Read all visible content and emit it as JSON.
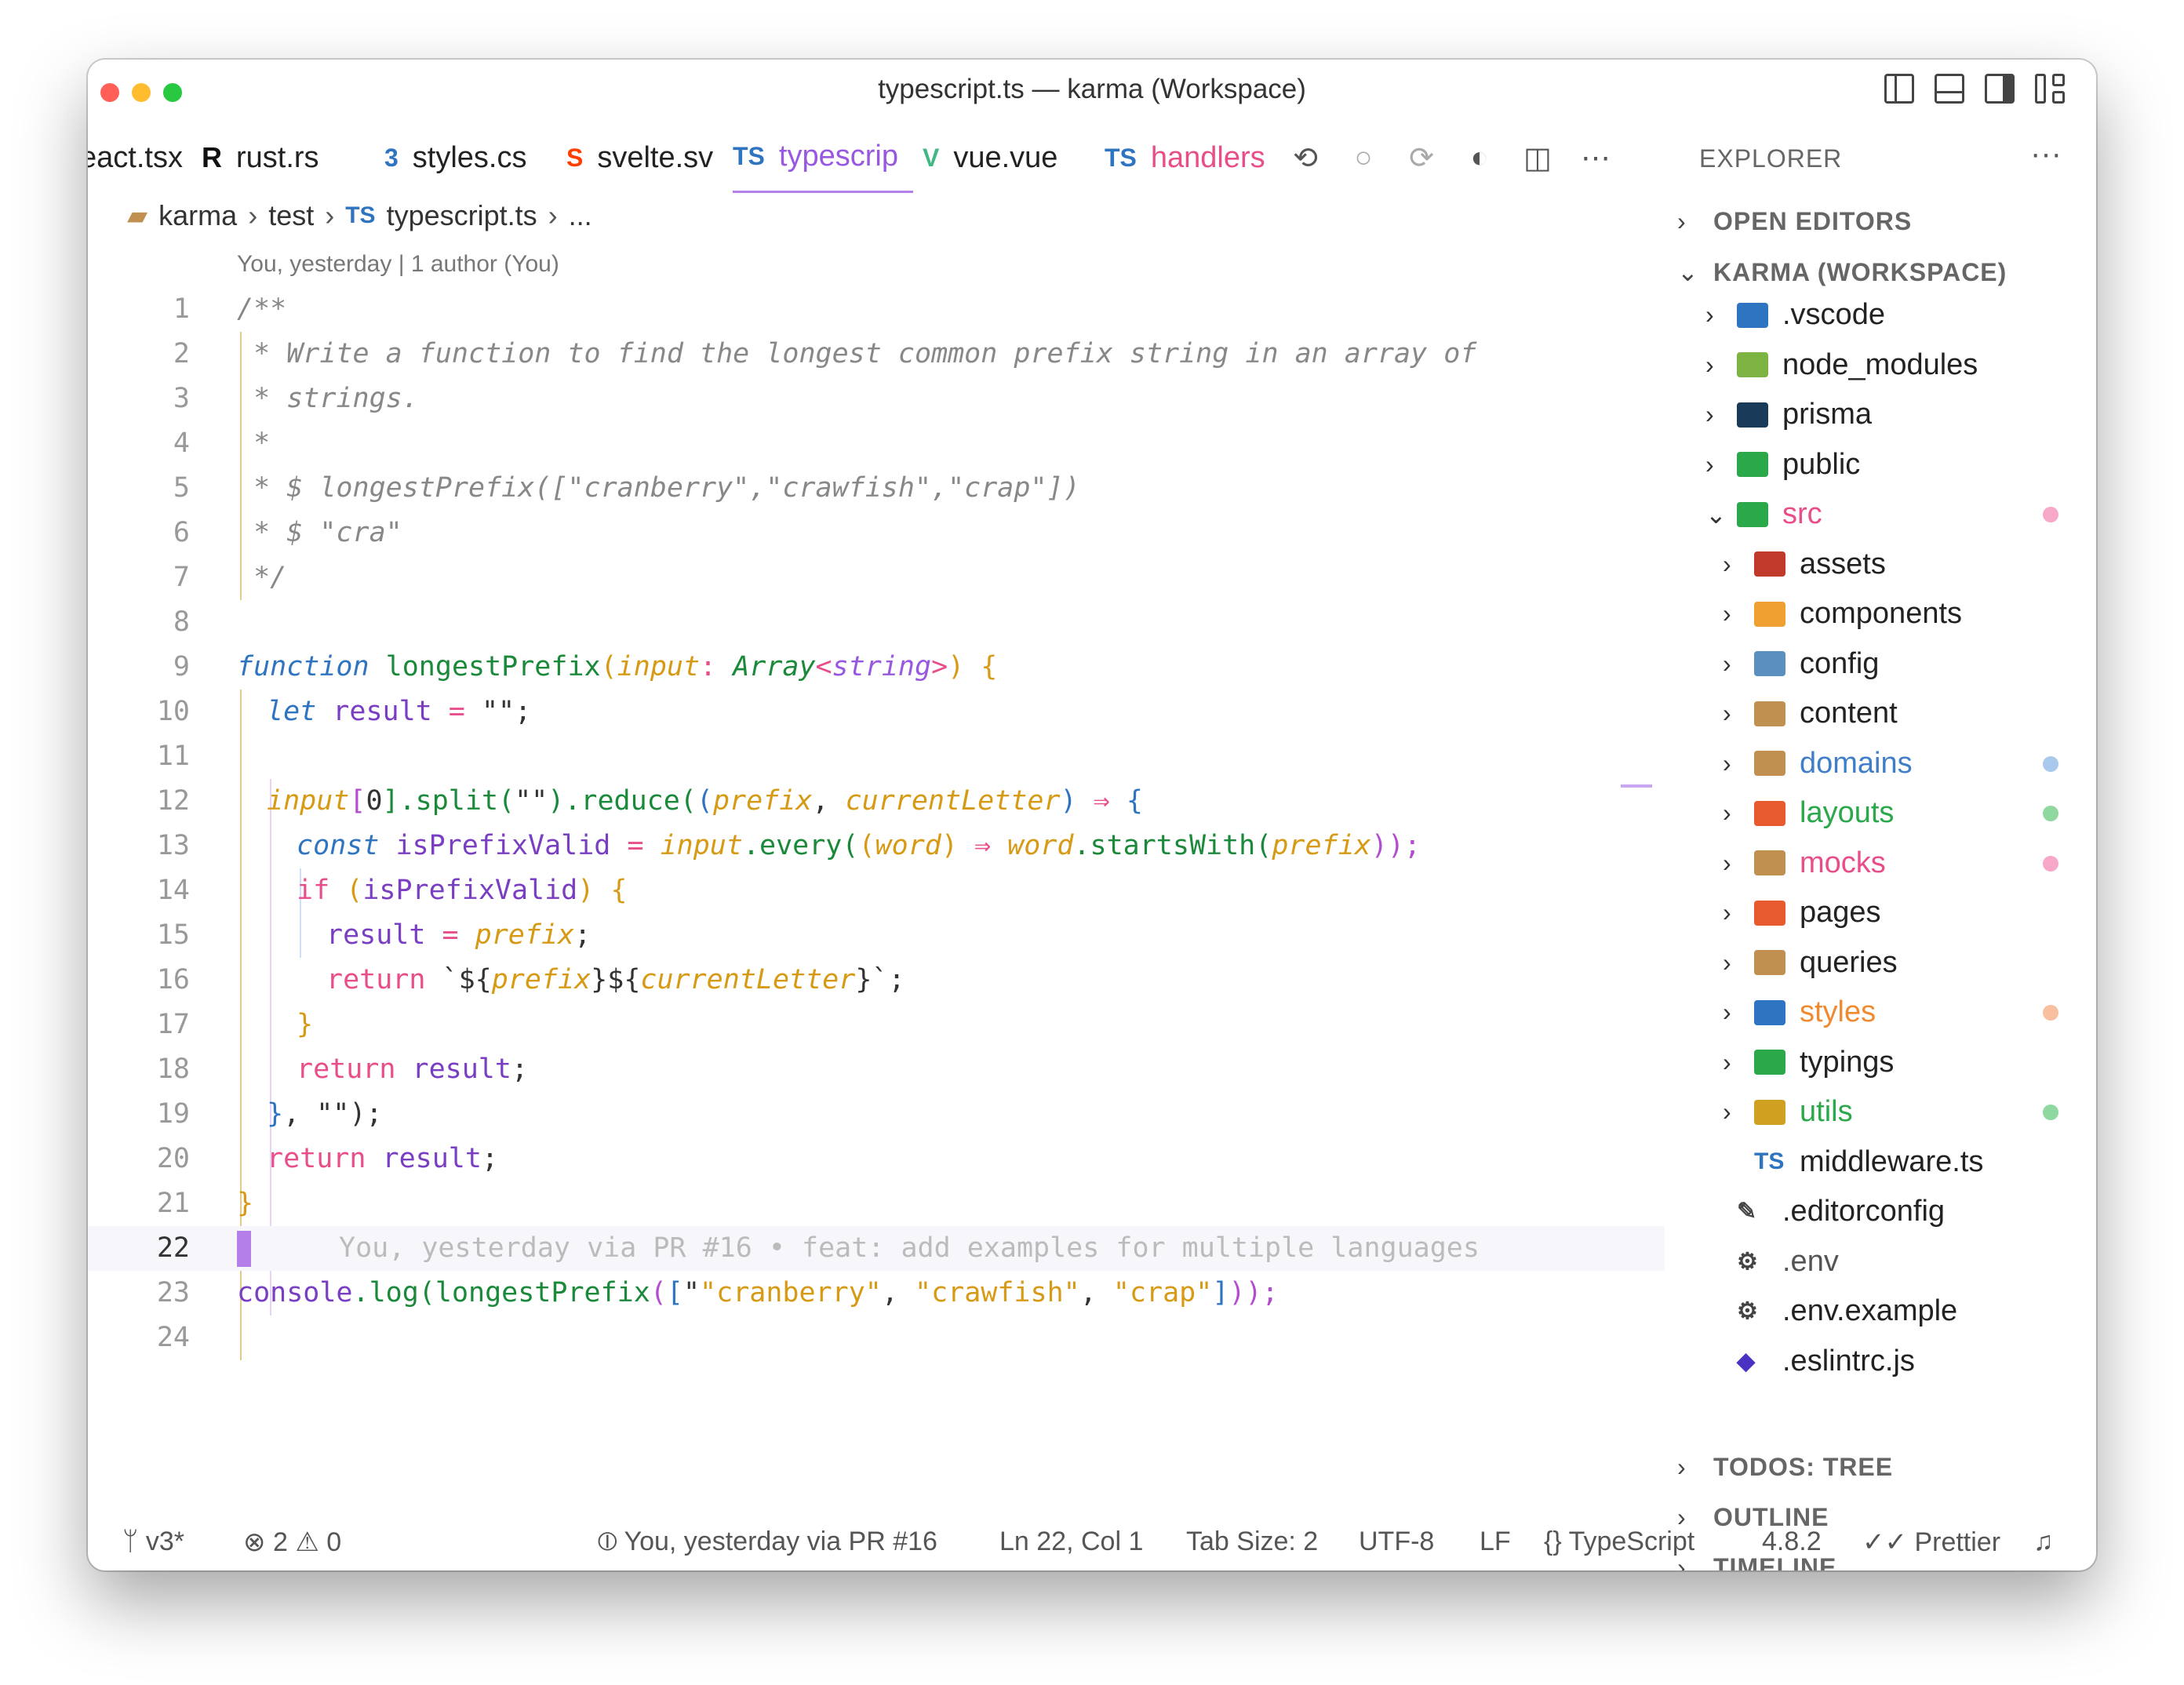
{
  "window": {
    "title": "typescript.ts — karma (Workspace)"
  },
  "tabs": [
    {
      "label": "eact.tsx",
      "icon": "react-icon"
    },
    {
      "label": "rust.rs",
      "icon": "rust-icon"
    },
    {
      "label": "styles.cs",
      "icon": "css-icon"
    },
    {
      "label": "svelte.sv",
      "icon": "svelte-icon"
    },
    {
      "label": "typescrip",
      "icon": "ts-icon",
      "active": true
    },
    {
      "label": "vue.vue",
      "icon": "vue-icon"
    },
    {
      "label": "handlers",
      "icon": "ts-icon"
    }
  ],
  "tab_icons": {
    "ts": "TS",
    "css": "3",
    "svelte": "S",
    "vue": "V",
    "rust": "R"
  },
  "breadcrumb": {
    "root": "karma",
    "folder": "test",
    "file": "typescript.ts",
    "more": "..."
  },
  "blame_top": "You, yesterday | 1 author (You)",
  "code_lines": [
    "1",
    "2",
    "3",
    "4",
    "5",
    "6",
    "7",
    "8",
    "9",
    "10",
    "11",
    "12",
    "13",
    "14",
    "15",
    "16",
    "17",
    "18",
    "19",
    "20",
    "21",
    "22",
    "23",
    "24"
  ],
  "code": {
    "l1": "/**",
    "l2": " * Write a function to find the longest common prefix string in an array of",
    "l3": " * strings.",
    "l4": " *",
    "l5": " * $ longestPrefix([\"cranberry\",\"crawfish\",\"crap\"])",
    "l6": " * $ \"cra\"",
    "l7": " */",
    "l9": {
      "kw": "function",
      "fn": "longestPrefix",
      "p1": "(",
      "param": "input",
      "colon": ": ",
      "type": "Array",
      "lt": "<",
      "tparam": "string",
      "gt": ">",
      "p2": ")",
      "brace": " {"
    },
    "l10": {
      "kw": "let",
      "var": "result",
      "eq": " = ",
      "str": "\"\"",
      "semi": ";"
    },
    "l12": {
      "a": "input",
      "b": "[",
      "c": "0",
      "d": "].split(",
      "e": "\"\"",
      "f": ").reduce(",
      "g": "(",
      "h": "prefix",
      "i": ", ",
      "j": "currentLetter",
      "k": ")",
      "l": " ⇒ ",
      "m": "{"
    },
    "l13": {
      "kw": "const",
      "var": "isPrefixValid",
      "eq": " = ",
      "a": "input",
      "b": ".every(",
      "c": "(",
      "d": "word",
      "e": ")",
      "f": " ⇒ ",
      "g": "word",
      "h": ".startsWith(",
      "i": "prefix",
      "j": "));"
    },
    "l14": {
      "kw": "if",
      "a": " (",
      "b": "isPrefixValid",
      "c": ") ",
      "d": "{"
    },
    "l15": {
      "var": "result",
      "eq": " = ",
      "a": "prefix",
      "semi": ";"
    },
    "l16": {
      "kw": "return",
      "a": " `${",
      "b": "prefix",
      "c": "}${",
      "d": "currentLetter",
      "e": "}`",
      "semi": ";"
    },
    "l17": "}",
    "l18": {
      "kw": "return",
      "var": " result",
      "semi": ";"
    },
    "l19": {
      "a": "}",
      "b": ", \"\");"
    },
    "l20": {
      "kw": "return",
      "var": " result",
      "semi": ";"
    },
    "l21": "}",
    "l22_blame": "You, yesterday via PR #16 • feat: add examples for multiple languages",
    "l23": {
      "a": "console",
      "b": ".log(",
      "c": "longestPrefix",
      "d": "(",
      "e": "[",
      "s1": "\"cranberry\"",
      "s2": "\"crawfish\"",
      "s3": "\"crap\"",
      "f": "]",
      "g": "));"
    }
  },
  "explorer": {
    "title": "EXPLORER",
    "more": "···",
    "open_editors": "OPEN EDITORS",
    "workspace": "KARMA (WORKSPACE)",
    "items": [
      {
        "label": ".vscode",
        "depth": 1,
        "folder": true,
        "color": "#222222",
        "icon_color": "#2f74c0"
      },
      {
        "label": "node_modules",
        "depth": 1,
        "folder": true,
        "color": "#222222",
        "icon_color": "#7cb342"
      },
      {
        "label": "prisma",
        "depth": 1,
        "folder": true,
        "color": "#222222",
        "icon_color": "#1a3a5a"
      },
      {
        "label": "public",
        "depth": 1,
        "folder": true,
        "color": "#222222",
        "icon_color": "#2aa84a"
      },
      {
        "label": "src",
        "depth": 1,
        "folder": true,
        "open": true,
        "color": "#e84e8a",
        "icon_color": "#2aa84a",
        "dot": "#f7a8c8"
      },
      {
        "label": "assets",
        "depth": 2,
        "folder": true,
        "color": "#222222",
        "icon_color": "#c0392b"
      },
      {
        "label": "components",
        "depth": 2,
        "folder": true,
        "color": "#222222",
        "icon_color": "#f0a030"
      },
      {
        "label": "config",
        "depth": 2,
        "folder": true,
        "color": "#222222",
        "icon_color": "#5a8fc0"
      },
      {
        "label": "content",
        "depth": 2,
        "folder": true,
        "color": "#222222",
        "icon_color": "#c09050"
      },
      {
        "label": "domains",
        "depth": 2,
        "folder": true,
        "color": "#3f7ec8",
        "icon_color": "#c09050",
        "dot": "#a8c8ec"
      },
      {
        "label": "layouts",
        "depth": 2,
        "folder": true,
        "color": "#2aa84a",
        "icon_color": "#e85a30",
        "dot": "#8fd8a0"
      },
      {
        "label": "mocks",
        "depth": 2,
        "folder": true,
        "color": "#e84e8a",
        "icon_color": "#c09050",
        "dot": "#f7a8c8"
      },
      {
        "label": "pages",
        "depth": 2,
        "folder": true,
        "color": "#222222",
        "icon_color": "#e85a30"
      },
      {
        "label": "queries",
        "depth": 2,
        "folder": true,
        "color": "#222222",
        "icon_color": "#c09050"
      },
      {
        "label": "styles",
        "depth": 2,
        "folder": true,
        "color": "#f08a30",
        "icon_color": "#2f74c0",
        "dot": "#f8c0a0"
      },
      {
        "label": "typings",
        "depth": 2,
        "folder": true,
        "color": "#222222",
        "icon_color": "#2aa84a"
      },
      {
        "label": "utils",
        "depth": 2,
        "folder": true,
        "color": "#2aa84a",
        "icon_color": "#d0a020",
        "dot": "#8fd8a0"
      },
      {
        "label": "middleware.ts",
        "depth": 2,
        "folder": false,
        "color": "#222222",
        "file_badge": "TS"
      },
      {
        "label": ".editorconfig",
        "depth": 1,
        "folder": false,
        "color": "#222222",
        "file_badge": "✎"
      },
      {
        "label": ".env",
        "depth": 1,
        "folder": false,
        "color": "#555555",
        "file_badge": "⚙"
      },
      {
        "label": ".env.example",
        "depth": 1,
        "folder": false,
        "color": "#222222",
        "file_badge": "⚙"
      },
      {
        "label": ".eslintrc.js",
        "depth": 1,
        "folder": false,
        "color": "#222222",
        "file_badge": "◆"
      }
    ],
    "sections_bottom": [
      "TODOS: TREE",
      "OUTLINE",
      "TIMELINE"
    ]
  },
  "statusbar": {
    "branch": "v3*",
    "errors": "2",
    "warnings": "0",
    "blame": "You, yesterday via PR #16",
    "cursor": "Ln 22, Col 1",
    "tab_size": "Tab Size: 2",
    "encoding": "UTF-8",
    "eol": "LF",
    "language": "TypeScript",
    "version": "4.8.2",
    "formatter": "Prettier"
  }
}
